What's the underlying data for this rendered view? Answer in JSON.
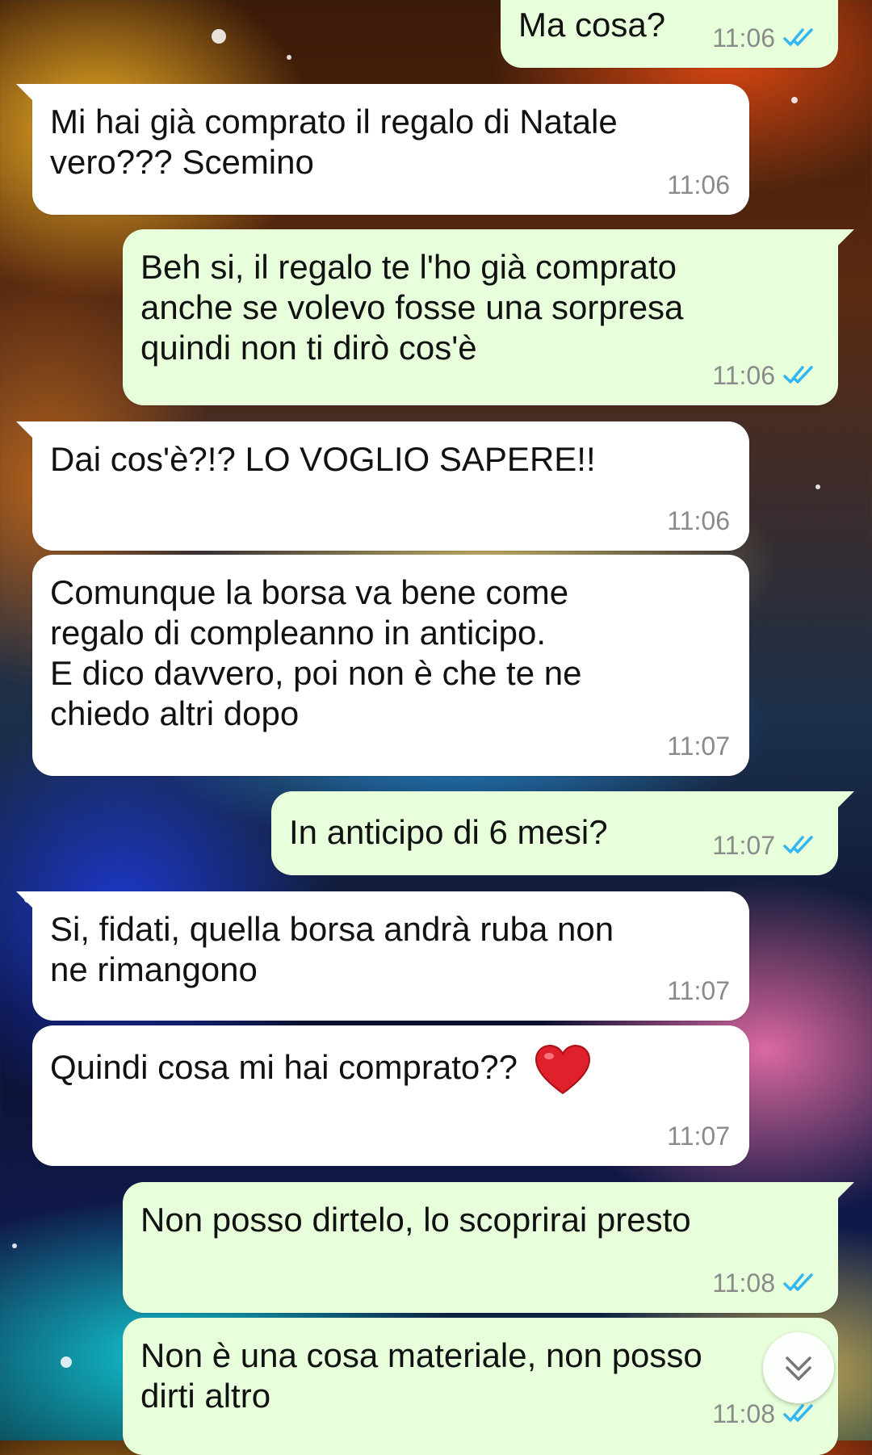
{
  "messages": [
    {
      "dir": "out",
      "text": "Ma cosa?",
      "time": "11:06",
      "read": true
    },
    {
      "dir": "in",
      "text": "Mi hai già comprato il regalo di Natale\nvero??? Scemino",
      "time": "11:06"
    },
    {
      "dir": "out",
      "text": "Beh si, il regalo te l'ho già comprato\nanche se volevo fosse una sorpresa\nquindi non ti dirò cos'è",
      "time": "11:06",
      "read": true
    },
    {
      "dir": "in",
      "text": "Dai cos'è?!? LO VOGLIO SAPERE!!",
      "time": "11:06"
    },
    {
      "dir": "in",
      "text": "Comunque la borsa va bene come\nregalo di compleanno in anticipo.\nE dico davvero, poi non è che te ne\nchiedo altri dopo",
      "time": "11:07"
    },
    {
      "dir": "out",
      "text": "In anticipo di 6 mesi?",
      "time": "11:07",
      "read": true
    },
    {
      "dir": "in",
      "text": "Si, fidati, quella borsa andrà ruba non\nne rimangono",
      "time": "11:07"
    },
    {
      "dir": "in",
      "text": "Quindi cosa mi hai comprato??",
      "emoji": "red-heart-icon",
      "time": "11:07"
    },
    {
      "dir": "out",
      "text": "Non posso dirtelo, lo scoprirai presto",
      "time": "11:08",
      "read": true
    },
    {
      "dir": "out",
      "text": "Non è una cosa materiale, non posso\ndirti altro",
      "time": "11:08",
      "read": true
    }
  ],
  "colors": {
    "incoming_bubble": "#ffffff",
    "outgoing_bubble": "#e7ffdb",
    "read_ticks": "#34b7f1",
    "timestamp": "#8a8a8a"
  },
  "scroll_button": {
    "icon": "double-chevron-down-icon"
  }
}
